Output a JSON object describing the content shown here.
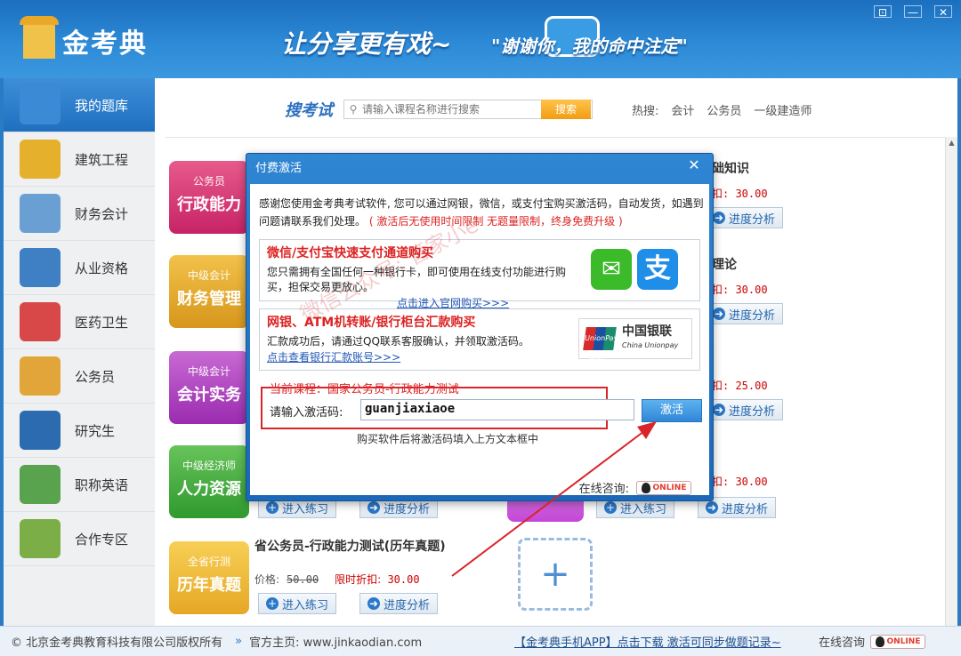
{
  "app": {
    "logo_text": "金考典",
    "slogan": "让分享更有戏~",
    "slogan2": "\"谢谢你，我的命中注定\"",
    "window_buttons": [
      "⊡",
      "—",
      "✕"
    ]
  },
  "sidebar": {
    "items": [
      {
        "label": "我的题库",
        "icon": "book-pen-icon",
        "color": "#3a8ad6",
        "active": true
      },
      {
        "label": "建筑工程",
        "icon": "construction-sign-icon",
        "color": "#e5b02b",
        "active": false
      },
      {
        "label": "财务会计",
        "icon": "chart-board-icon",
        "color": "#6a9fd3",
        "active": false
      },
      {
        "label": "从业资格",
        "icon": "building-blocks-icon",
        "color": "#3f7fc4",
        "active": false
      },
      {
        "label": "医药卫生",
        "icon": "medical-kit-icon",
        "color": "#d84848",
        "active": false
      },
      {
        "label": "公务员",
        "icon": "documents-icon",
        "color": "#e2a53a",
        "active": false
      },
      {
        "label": "研究生",
        "icon": "layers-icon",
        "color": "#2d6bb0",
        "active": false
      },
      {
        "label": "职称英语",
        "icon": "letter-a-plus-icon",
        "color": "#5aa34e",
        "active": false
      },
      {
        "label": "合作专区",
        "icon": "compass-map-icon",
        "color": "#7cae48",
        "active": false
      }
    ]
  },
  "search": {
    "title": "搜考试",
    "placeholder": "请输入课程名称进行搜索",
    "button": "搜索",
    "hot_label": "热搜:",
    "hot_terms": [
      "会计",
      "公务员",
      "一级建造师"
    ]
  },
  "cards": [
    {
      "small": "公务员",
      "big": "行政能力"
    },
    {
      "small": "中级会计",
      "big": "财务管理"
    },
    {
      "small": "中级会计",
      "big": "会计实务"
    },
    {
      "small": "中级经济师",
      "big": "人力资源"
    },
    {
      "small": "全省行测",
      "big": "历年真题"
    }
  ],
  "right_items": {
    "title1_fragment": "础知识",
    "title2_fragment": "理论",
    "discount_prices": [
      "扣: 30.00",
      "扣: 30.00",
      "扣: 25.00",
      "扣: 30.00"
    ],
    "analysis_label": "进度分析",
    "practice_label": "进入练习"
  },
  "last_course": {
    "title": "省公务员-行政能力测试(历年真题)",
    "price_label": "价格:",
    "old_price": "50.00",
    "discount_label": "限时折扣:",
    "discount_price": "30.00"
  },
  "dialog": {
    "title": "付费激活",
    "close": "✕",
    "intro": "感谢您使用金考典考试软件, 您可以通过网银，微信，或支付宝购买激活码，自动发货，如遇到问题请联系我们处理。",
    "intro_warn": "( 激活后无使用时间限制 无题量限制，终身免费升级 )",
    "panel1": {
      "heading": "微信/支付宝快速支付通道购买",
      "text": "您只需拥有全国任何一种银行卡，即可使用在线支付功能进行购买，担保交易更放心。",
      "link": "点击进入官网购买>>>"
    },
    "panel2": {
      "heading": "网银、ATM机转账/银行柜台汇款购买",
      "text": "汇款成功后，请通过QQ联系客服确认，并领取激活码。",
      "link": "点击查看银行汇款账号>>>",
      "unionpay_label": "中国银联",
      "unionpay_sub": "China Unionpay",
      "unionpay_logo": "UnionPay 银联"
    },
    "current_course": "当前课程：国家公务员-行政能力测试",
    "code_label": "请输入激活码:",
    "code_value": "guanjiaxiaoe",
    "activate_button": "激活",
    "hint": "购买软件后将激活码填入上方文本框中",
    "online_label": "在线咨询:",
    "qq_badge": "ONLINE"
  },
  "watermark": "微信公众号: 管家小e",
  "footer": {
    "copyright": "© 北京金考典教育科技有限公司版权所有",
    "home_label": "官方主页: www.jinkaodian.com",
    "app_link": "【金考典手机APP】点击下载 激活可同步做题记录~",
    "online": "在线咨询",
    "qq_badge": "ONLINE"
  }
}
